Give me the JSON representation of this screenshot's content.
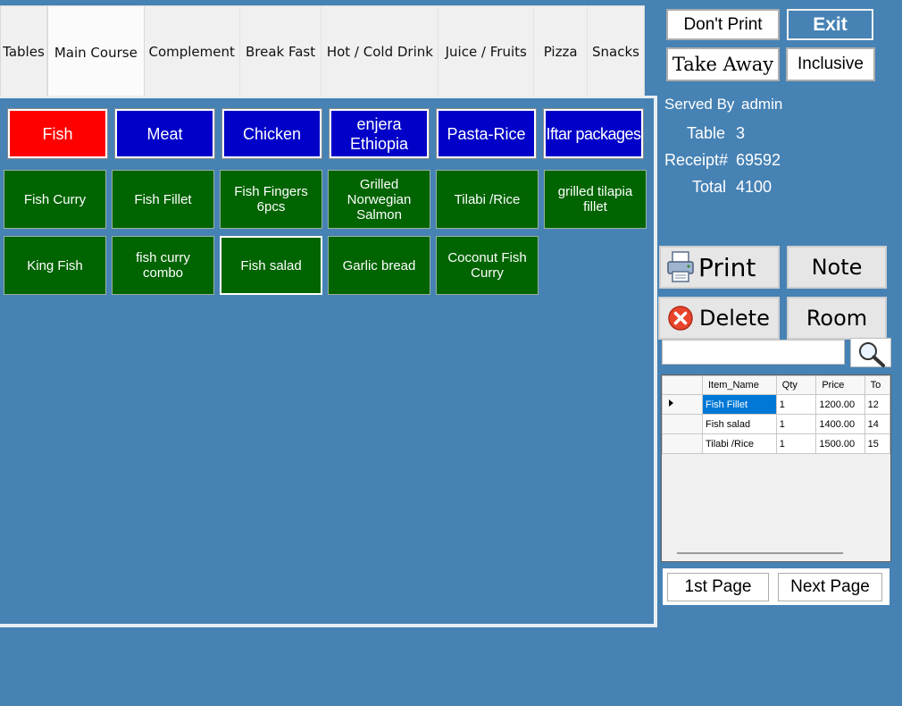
{
  "tabs": [
    "Tables",
    "Main Course",
    "Complement",
    "Break Fast",
    "Hot / Cold Drink",
    "Juice / Fruits",
    "Pizza",
    "Snacks"
  ],
  "categories": [
    {
      "line1": "Fish",
      "line2": "",
      "color": "#ff0000"
    },
    {
      "line1": "Meat",
      "line2": "",
      "color": "#0000c8"
    },
    {
      "line1": "Chicken",
      "line2": "",
      "color": "#0000c8"
    },
    {
      "line1": "enjera",
      "line2": "Ethiopia",
      "color": "#0000c8"
    },
    {
      "line1": "Pasta-Rice",
      "line2": "",
      "color": "#0000c8"
    },
    {
      "line1": "Iftar packages",
      "line2": "",
      "color": "#0000c8"
    }
  ],
  "items": [
    [
      "Fish Curry"
    ],
    [
      "Fish Fillet"
    ],
    [
      "Fish Fingers",
      "6pcs"
    ],
    [
      "Grilled",
      "Norwegian",
      "Salmon"
    ],
    [
      "Tilabi /Rice"
    ],
    [
      "grilled tilapia",
      "fillet"
    ],
    [
      "King Fish"
    ],
    [
      "fish curry",
      "combo"
    ],
    [
      "Fish salad"
    ],
    [
      "Garlic bread"
    ],
    [
      "Coconut Fish",
      "Curry"
    ]
  ],
  "controls": {
    "dont_print": "Don't Print",
    "exit": "Exit",
    "take_away": "Take Away",
    "inclusive": "Inclusive",
    "print": "Print",
    "note": "Note",
    "delete": "Delete",
    "room": "Room",
    "first_page": "1st Page",
    "next_page": "Next Page"
  },
  "info": {
    "served_by_label": "Served By",
    "served_by": "admin",
    "table_label": "Table",
    "table": "3",
    "receipt_label": "Receipt#",
    "receipt": "69592",
    "total_label": "Total",
    "total": "4100"
  },
  "search": {
    "placeholder": ""
  },
  "order_grid": {
    "headers": [
      "Item_Name",
      "Qty",
      "Price",
      "To"
    ],
    "rows": [
      {
        "name": "Fish Fillet",
        "qty": "1",
        "price": "1200.00",
        "t": "12"
      },
      {
        "name": "Fish salad",
        "qty": "1",
        "price": "1400.00",
        "t": "14"
      },
      {
        "name": "Tilabi /Rice",
        "qty": "1",
        "price": "1500.00",
        "t": "15"
      }
    ]
  },
  "colors": {
    "background": "#4682b4",
    "category_selected": "#ff0000",
    "category": "#0000c8",
    "item": "#006400",
    "grid_selection": "#0078d7"
  },
  "icons": [
    "printer-icon",
    "delete-x-icon",
    "magnifier-icon",
    "row-pointer-icon"
  ]
}
